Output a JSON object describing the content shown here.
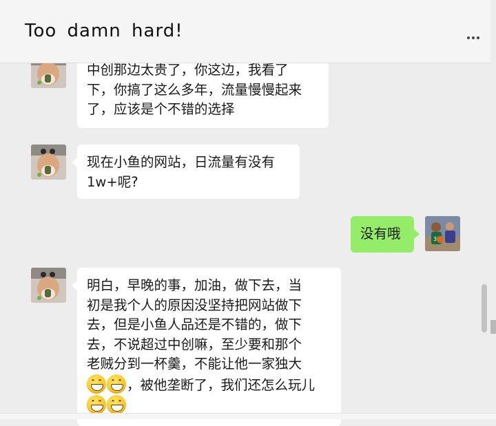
{
  "header": {
    "title": "Too  damn  hard!"
  },
  "messages": [
    {
      "id": "m1",
      "sender": "other",
      "lines": [
        "中创那边太贵了，你这边，我看了",
        "下，你搞了这么多年，流量慢慢起来",
        "了，应该是个不错的选择"
      ]
    },
    {
      "id": "m2",
      "sender": "other",
      "lines": [
        "现在小鱼的网站，日流量有没有",
        "1w+呢?"
      ]
    },
    {
      "id": "m3",
      "sender": "me",
      "lines": [
        "没有哦"
      ]
    },
    {
      "id": "m4",
      "sender": "other",
      "lines": [
        "明白，早晚的事，加油，做下去，当",
        "初是我个人的原因没坚持把网站做下",
        "去，但是小鱼人品还是不错的，做下",
        "去，不说超过中创嘛，至少要和那个",
        "老贼分到一杯羹，不能让他一家独大"
      ],
      "line6_text": "，被他垄断了，我们还怎么玩儿"
    }
  ],
  "icons": {
    "more": "more-dots-icon",
    "emoji": "grinning-emoji-icon",
    "avatar_other": "contact-avatar-cat",
    "avatar_me": "own-avatar-basketball"
  },
  "colors": {
    "background": "#ededed",
    "my_bubble": "#95ec69",
    "other_bubble": "#ffffff"
  }
}
